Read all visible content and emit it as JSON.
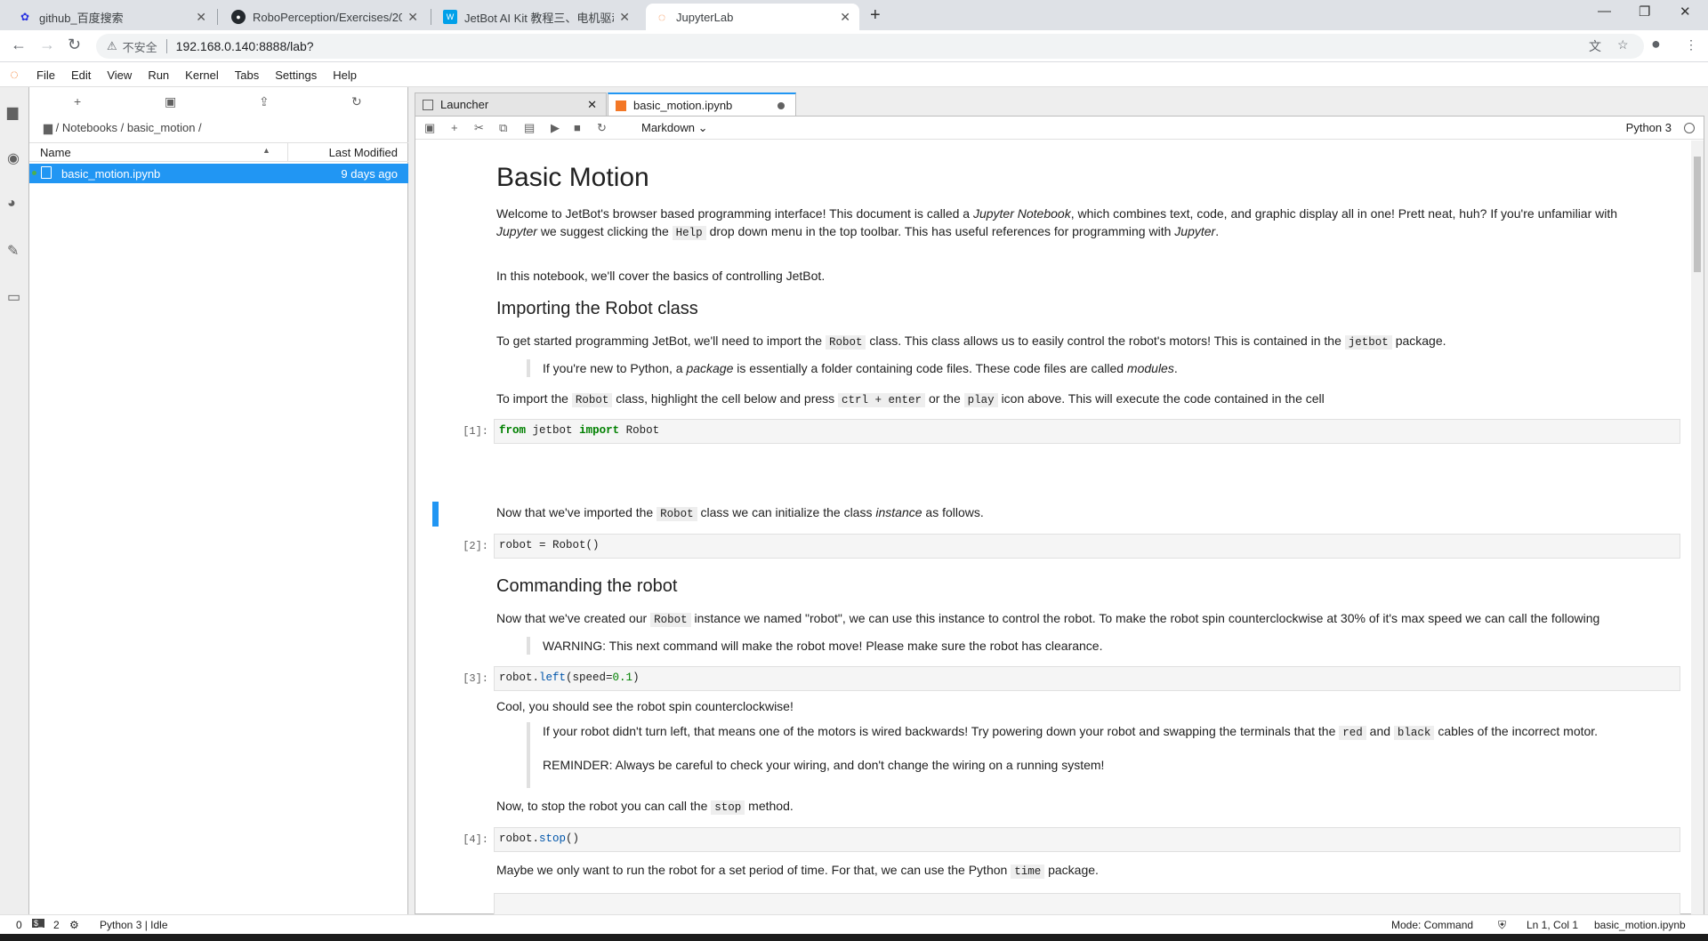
{
  "browser": {
    "tabs": [
      {
        "title": "github_百度搜索",
        "icon": "baidu-icon"
      },
      {
        "title": "RoboPerception/Exercises/2021",
        "icon": "github-icon"
      },
      {
        "title": "JetBot AI Kit 教程三、电机驱动",
        "icon": "waveshare-icon"
      },
      {
        "title": "JupyterLab",
        "icon": "jupyter-icon"
      }
    ],
    "address": {
      "security": "不安全",
      "url": "192.168.0.140:8888/lab?"
    }
  },
  "jupyter": {
    "menu": [
      "File",
      "Edit",
      "View",
      "Run",
      "Kernel",
      "Tabs",
      "Settings",
      "Help"
    ],
    "filebrowser": {
      "breadcrumb": "/ Notebooks / basic_motion /",
      "col_name": "Name",
      "col_modified": "Last Modified",
      "files": [
        {
          "name": "basic_motion.ipynb",
          "modified": "9 days ago"
        }
      ]
    },
    "doc_tabs": [
      {
        "label": "Launcher"
      },
      {
        "label": "basic_motion.ipynb"
      }
    ],
    "toolbar": {
      "cell_type": "Markdown",
      "kernel": "Python 3"
    },
    "notebook": {
      "title": "Basic Motion",
      "intro_1": "Welcome to JetBot's browser based programming interface! This document is called a",
      "intro_em": "Jupyter Notebook",
      "intro_2": ", which combines text, code, and graphic display all in one! Prett neat, huh? If you're unfamiliar with",
      "intro_em2": "Jupyter",
      "intro_3": "we suggest clicking the",
      "intro_code": "Help",
      "intro_4": "drop down menu in the top toolbar. This has useful references for programming with",
      "intro_em3": "Jupyter",
      "intro_5": ".",
      "p_cover": "In this notebook, we'll cover the basics of controlling JetBot.",
      "h_import": "Importing the Robot class",
      "p_import_1": "To get started programming JetBot, we'll need to import the",
      "p_import_code1": "Robot",
      "p_import_2": "class. This class allows us to easily control the robot's motors! This is contained in the",
      "p_import_code2": "jetbot",
      "p_import_3": "package.",
      "q_pkg_1": "If you're new to Python, a",
      "q_pkg_em": "package",
      "q_pkg_2": "is essentially a folder containing code files. These code files are called",
      "q_pkg_em2": "modules",
      "q_pkg_3": ".",
      "p_how_1": "To import the",
      "p_how_code1": "Robot",
      "p_how_2": "class, highlight the cell below and press",
      "p_how_code2": "ctrl + enter",
      "p_how_3": "or the",
      "p_how_code3": "play",
      "p_how_4": "icon above. This will execute the code contained in the cell",
      "cell1_prompt": "[1]:",
      "cell1_kw1": "from",
      "cell1_mod": "jetbot",
      "cell1_kw2": "import",
      "cell1_name": "Robot",
      "p_init_1": "Now that we've imported the",
      "p_init_code": "Robot",
      "p_init_2": "class we can initialize the class",
      "p_init_em": "instance",
      "p_init_3": "as follows.",
      "cell2_prompt": "[2]:",
      "cell2_code": "robot = Robot()",
      "h_cmd": "Commanding the robot",
      "p_cmd_1": "Now that we've created our",
      "p_cmd_code": "Robot",
      "p_cmd_2": "instance we named \"robot\", we can use this instance to control the robot. To make the robot spin counterclockwise at 30% of it's max speed we can call the following",
      "q_warn": "WARNING: This next command will make the robot move! Please make sure the robot has clearance.",
      "cell3_prompt": "[3]:",
      "cell3_obj": "robot.",
      "cell3_fn": "left",
      "cell3_args": "(speed=",
      "cell3_num": "0.1",
      "cell3_end": ")",
      "p_cool": "Cool, you should see the robot spin counterclockwise!",
      "q_left_1": "If your robot didn't turn left, that means one of the motors is wired backwards! Try powering down your robot and swapping the terminals that the",
      "q_left_code1": "red",
      "q_left_2": "and",
      "q_left_code2": "black",
      "q_left_3": "cables of the incorrect motor.",
      "q_remind": "REMINDER: Always be careful to check your wiring, and don't change the wiring on a running system!",
      "p_stop_1": "Now, to stop the robot you can call the",
      "p_stop_code": "stop",
      "p_stop_2": "method.",
      "cell4_prompt": "[4]:",
      "cell4_obj": "robot.",
      "cell4_fn": "stop",
      "cell4_end": "()",
      "p_time_1": "Maybe we only want to run the robot for a set period of time. For that, we can use the Python",
      "p_time_code": "time",
      "p_time_2": "package."
    },
    "status": {
      "left_count": "0",
      "terminals": "2",
      "kernel": "Python 3 | Idle",
      "mode": "Mode: Command",
      "position": "Ln 1, Col 1",
      "file": "basic_motion.ipynb"
    }
  },
  "colors": {
    "accent": "#2196f3",
    "jupyter_orange": "#f37726"
  }
}
